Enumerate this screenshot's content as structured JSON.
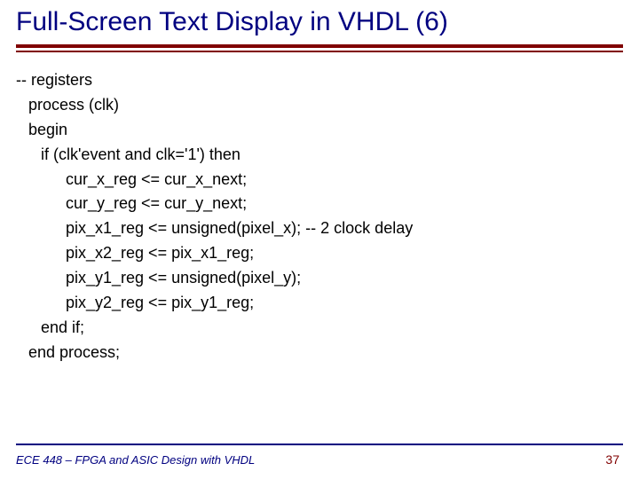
{
  "title": "Full-Screen Text Display in VHDL (6)",
  "code": {
    "l0": "-- registers",
    "l1": "process (clk)",
    "l2": "begin",
    "l3": "if (clk'event and clk='1') then",
    "l4": "cur_x_reg <= cur_x_next;",
    "l5": "cur_y_reg <= cur_y_next;",
    "l6": "pix_x1_reg <= unsigned(pixel_x); -- 2 clock delay",
    "l7": "pix_x2_reg <= pix_x1_reg;",
    "l8": "pix_y1_reg <= unsigned(pixel_y);",
    "l9": "pix_y2_reg <= pix_y1_reg;",
    "l10": "end if;",
    "l11": "end process;"
  },
  "footer": {
    "left": "ECE 448 – FPGA and ASIC Design with VHDL",
    "page": "37"
  }
}
